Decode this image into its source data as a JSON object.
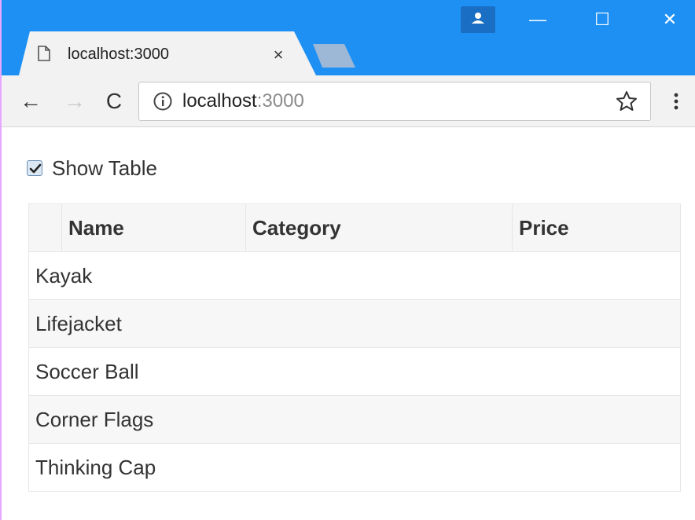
{
  "browser": {
    "tab": {
      "title": "localhost:3000",
      "close": "×"
    },
    "window_controls": {
      "minimize": "—",
      "maximize": "☐",
      "close": "✕"
    },
    "url": {
      "host": "localhost",
      "port": ":3000"
    },
    "nav": {
      "back": "←",
      "forward": "→",
      "reload": "C"
    }
  },
  "page": {
    "checkbox": {
      "label": "Show Table",
      "checked": true
    },
    "table": {
      "headers": [
        "",
        "Name",
        "Category",
        "Price"
      ],
      "rows": [
        "Kayak",
        "Lifejacket",
        "Soccer Ball",
        "Corner Flags",
        "Thinking Cap"
      ]
    }
  },
  "colors": {
    "titlebar": "#1e90f4",
    "tab": "#f2f2f2",
    "stripe": "#f7f7f7"
  }
}
